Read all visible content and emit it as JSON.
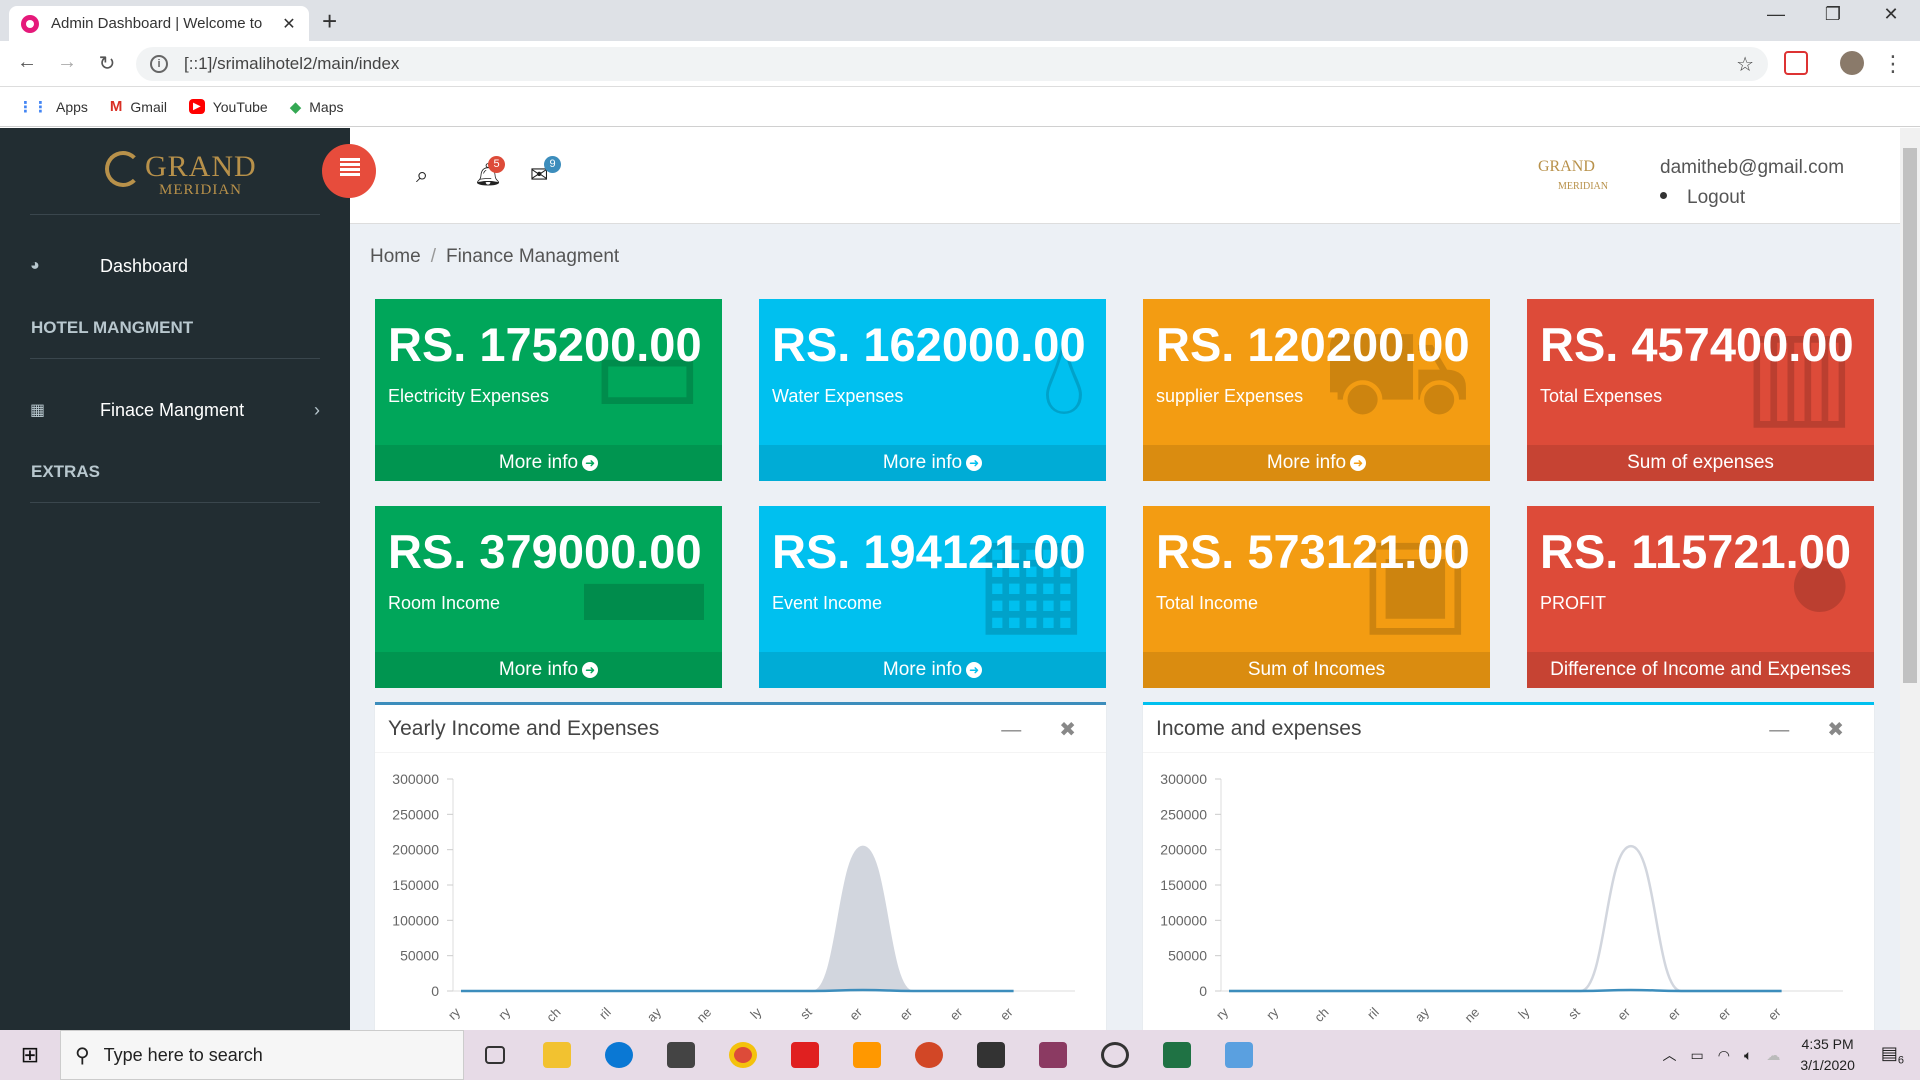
{
  "browser": {
    "tab_title": "Admin Dashboard | Welcome to ",
    "url": "[::1]/srimalihotel2/main/index",
    "bookmarks": [
      {
        "label": "Apps",
        "icon": "apps-grid-icon"
      },
      {
        "label": "Gmail",
        "icon": "gmail-icon"
      },
      {
        "label": "YouTube",
        "icon": "youtube-icon"
      },
      {
        "label": "Maps",
        "icon": "maps-icon"
      }
    ]
  },
  "sidebar": {
    "logo_main": "GRAND",
    "logo_sub": "MERIDIAN",
    "dashboard": "Dashboard",
    "hotel_heading": "HOTEL MANGMENT",
    "finance": "Finace Mangment",
    "extras_heading": "EXTRAS"
  },
  "topnav": {
    "notifications": "5",
    "messages": "9",
    "email": "damitheb@gmail.com",
    "logout": "Logout",
    "logo_main": "GRAND",
    "logo_sub": "MERIDIAN"
  },
  "breadcrumb": {
    "home": "Home",
    "current": "Finance Managment"
  },
  "boxes": [
    {
      "value": "RS. 175200.00",
      "label": "Electricity Expenses",
      "footer": "More info",
      "color": "#00a65a",
      "icon": "money-icon",
      "has_arrow": true
    },
    {
      "value": "RS. 162000.00",
      "label": "Water Expenses",
      "footer": "More info",
      "color": "#00c0ef",
      "icon": "water-drop-icon",
      "has_arrow": true
    },
    {
      "value": "RS. 120200.00",
      "label": "supplier Expenses",
      "footer": "More info",
      "color": "#f39c12",
      "icon": "truck-icon",
      "has_arrow": true
    },
    {
      "value": "RS. 457400.00",
      "label": "Total Expenses",
      "footer": "Sum of expenses",
      "color": "#dd4b39",
      "icon": "bar-chart-icon",
      "has_arrow": false
    },
    {
      "value": "RS. 379000.00",
      "label": "Room Income",
      "footer": "More info",
      "color": "#00a65a",
      "icon": "bed-icon",
      "has_arrow": true
    },
    {
      "value": "RS. 194121.00",
      "label": "Event Income",
      "footer": "More info",
      "color": "#00c0ef",
      "icon": "calendar-icon",
      "has_arrow": true
    },
    {
      "value": "RS. 573121.00",
      "label": "Total Income",
      "footer": "Sum of Incomes",
      "color": "#f39c12",
      "icon": "money-bill-icon",
      "has_arrow": false
    },
    {
      "value": "RS. 115721.00",
      "label": "PROFIT",
      "footer": "Difference of Income and Expenses",
      "color": "#dd4b39",
      "icon": "pie-chart-icon",
      "has_arrow": false
    }
  ],
  "panels": [
    {
      "title": "Yearly Income and Expenses",
      "accent": "#3c8dbc"
    },
    {
      "title": "Income and expenses",
      "accent": "#00c0ef"
    }
  ],
  "chart_data": [
    {
      "type": "area",
      "title": "Yearly Income and Expenses",
      "categories": [
        "January",
        "February",
        "March",
        "April",
        "May",
        "June",
        "July",
        "August",
        "September",
        "October",
        "November",
        "December"
      ],
      "category_ticks": [
        "ry",
        "ry",
        "ch",
        "ril",
        "ay",
        "ne",
        "ly",
        "st",
        "er",
        "er",
        "er",
        "er"
      ],
      "yticks": [
        300000,
        250000,
        200000,
        150000,
        100000,
        50000,
        0
      ],
      "ylim": [
        0,
        300000
      ],
      "series": [
        {
          "values": [
            0,
            0,
            0,
            0,
            0,
            0,
            0,
            0,
            205000,
            0,
            0,
            0
          ],
          "color": "#d2d6de",
          "fill": true
        },
        {
          "values": [
            0,
            0,
            0,
            0,
            0,
            0,
            0,
            0,
            1500,
            0,
            0,
            0
          ],
          "color": "#3c8dbc",
          "fill": false
        }
      ]
    },
    {
      "type": "line",
      "title": "Income and expenses",
      "categories": [
        "January",
        "February",
        "March",
        "April",
        "May",
        "June",
        "July",
        "August",
        "September",
        "October",
        "November",
        "December"
      ],
      "category_ticks": [
        "ry",
        "ry",
        "ch",
        "ril",
        "ay",
        "ne",
        "ly",
        "st",
        "er",
        "er",
        "er",
        "er"
      ],
      "yticks": [
        300000,
        250000,
        200000,
        150000,
        100000,
        50000,
        0
      ],
      "ylim": [
        0,
        300000
      ],
      "series": [
        {
          "values": [
            0,
            0,
            0,
            0,
            0,
            0,
            0,
            0,
            205000,
            0,
            0,
            0
          ],
          "color": "#d2d6de",
          "fill": false
        },
        {
          "values": [
            0,
            0,
            0,
            0,
            0,
            0,
            0,
            0,
            1500,
            0,
            0,
            0
          ],
          "color": "#3c8dbc",
          "fill": false
        }
      ]
    }
  ],
  "taskbar": {
    "search_placeholder": "Type here to search",
    "time": "4:35 PM",
    "date": "3/1/2020",
    "notif_count": "6"
  }
}
